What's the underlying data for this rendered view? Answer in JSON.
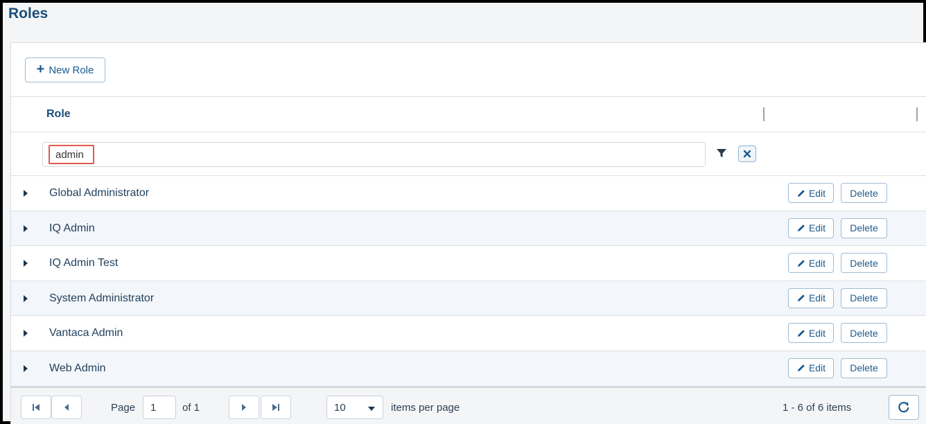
{
  "page": {
    "title": "Roles"
  },
  "toolbar": {
    "new_role_label": "New Role"
  },
  "grid": {
    "column_header": "Role",
    "filter": {
      "value": "admin"
    },
    "row_actions": {
      "edit_label": "Edit",
      "delete_label": "Delete"
    },
    "rows": [
      {
        "name": "Global Administrator"
      },
      {
        "name": "IQ Admin"
      },
      {
        "name": "IQ Admin Test"
      },
      {
        "name": "System Administrator"
      },
      {
        "name": "Vantaca Admin"
      },
      {
        "name": "Web Admin"
      }
    ]
  },
  "pager": {
    "page_label": "Page",
    "current_page": "1",
    "of_label": "of 1",
    "per_page_value": "10",
    "per_page_label": "items per page",
    "summary": "1 - 6 of 6 items"
  },
  "colors": {
    "accent": "#1b5a8e",
    "title": "#1b4d7a",
    "highlight": "#e05a4a",
    "row_alt": "#f3f6fa"
  }
}
